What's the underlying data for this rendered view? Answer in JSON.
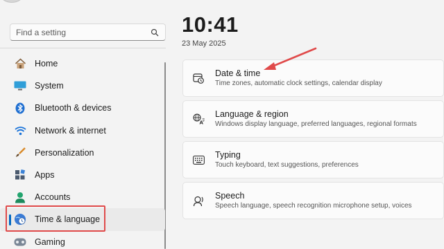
{
  "search": {
    "placeholder": "Find a setting"
  },
  "sidebar": {
    "items": [
      {
        "label": "Home",
        "icon": "home-icon"
      },
      {
        "label": "System",
        "icon": "monitor-icon"
      },
      {
        "label": "Bluetooth & devices",
        "icon": "bluetooth-icon"
      },
      {
        "label": "Network & internet",
        "icon": "wifi-icon"
      },
      {
        "label": "Personalization",
        "icon": "paintbrush-icon"
      },
      {
        "label": "Apps",
        "icon": "apps-icon"
      },
      {
        "label": "Accounts",
        "icon": "person-icon"
      },
      {
        "label": "Time & language",
        "icon": "globe-clock-icon",
        "selected": true
      },
      {
        "label": "Gaming",
        "icon": "gamepad-icon"
      }
    ]
  },
  "header": {
    "time": "10:41",
    "date": "23 May 2025"
  },
  "cards": [
    {
      "title": "Date & time",
      "subtitle": "Time zones, automatic clock settings, calendar display",
      "icon": "calendar-clock-icon"
    },
    {
      "title": "Language & region",
      "subtitle": "Windows display language, preferred languages, regional formats",
      "icon": "language-icon"
    },
    {
      "title": "Typing",
      "subtitle": "Touch keyboard, text suggestions, preferences",
      "icon": "keyboard-icon"
    },
    {
      "title": "Speech",
      "subtitle": "Speech language, speech recognition microphone setup, voices",
      "icon": "speech-icon"
    }
  ],
  "colors": {
    "accent": "#0067c0",
    "annotation": "#e04a4a",
    "background": "#f3f3f3",
    "card": "#fbfbfb"
  }
}
